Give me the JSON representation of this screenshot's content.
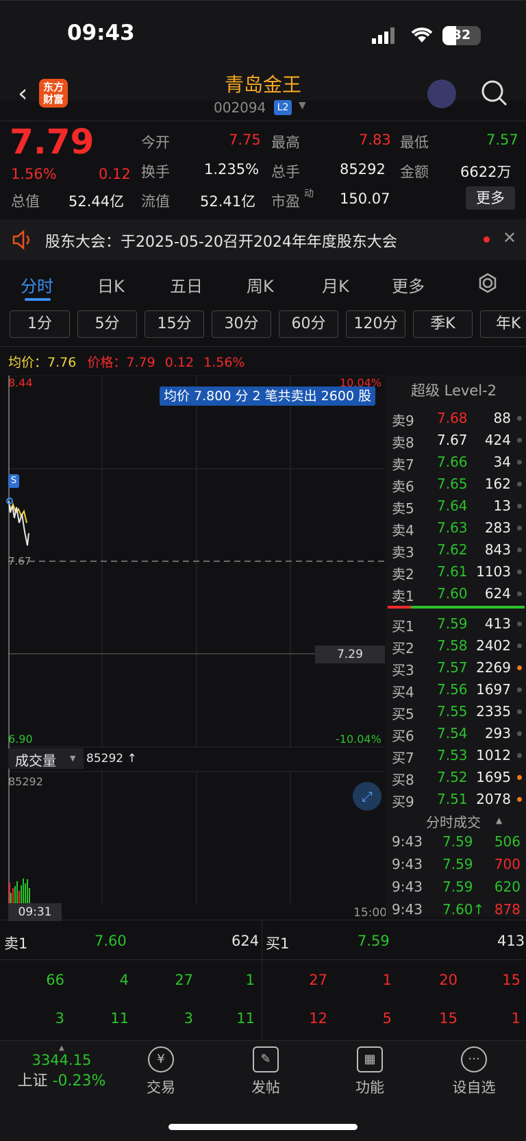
{
  "status": {
    "time": "09:43",
    "battery": "32"
  },
  "header": {
    "logo": "东方财富",
    "name": "青岛金王",
    "code": "002094",
    "badge": "L2"
  },
  "quote": {
    "price": "7.79",
    "pct": "1.56%",
    "chg": "0.12",
    "open_label": "今开",
    "open": "7.75",
    "high_label": "最高",
    "high": "7.83",
    "low_label": "最低",
    "low": "7.57",
    "turnover_label": "换手",
    "turnover": "1.235%",
    "vol_label": "总手",
    "vol": "85292",
    "amount_label": "金额",
    "amount": "6622万",
    "mcap_label": "总值",
    "mcap": "52.44亿",
    "float_label": "流值",
    "float": "52.41亿",
    "pe_label": "市盈",
    "pe_sup": "动",
    "pe": "150.07",
    "more": "更多"
  },
  "notice": {
    "text": "股东大会：于2025-05-20召开2024年年度股东大会"
  },
  "tabs": [
    "分时",
    "日K",
    "五日",
    "周K",
    "月K",
    "更多"
  ],
  "periods": [
    "1分",
    "5分",
    "15分",
    "30分",
    "60分",
    "120分",
    "季K",
    "年K"
  ],
  "legend": {
    "avg_label": "均价：",
    "avg": "7.76",
    "price_label": "价格：",
    "price": "7.79",
    "chg": "0.12",
    "pct": "1.56%"
  },
  "chart": {
    "y_top": "8.44",
    "y_bottom": "6.90",
    "pct_top": "10.04%",
    "pct_bottom": "-10.04%",
    "ref": "7.67",
    "cross": "7.29",
    "tooltip": "均价 7.800 分 2 笔共卖出 2600 股",
    "vol_label": "成交量",
    "vol_value": "85292 ↑",
    "vol_max": "85292",
    "t_start": "09:31",
    "t_end": "15:00"
  },
  "orderbook": {
    "title": "超级 Level-2",
    "sells": [
      {
        "l": "卖9",
        "p": "7.68",
        "v": "88",
        "c": "red"
      },
      {
        "l": "卖8",
        "p": "7.67",
        "v": "424",
        "c": "white"
      },
      {
        "l": "卖7",
        "p": "7.66",
        "v": "34",
        "c": "green"
      },
      {
        "l": "卖6",
        "p": "7.65",
        "v": "162",
        "c": "green"
      },
      {
        "l": "卖5",
        "p": "7.64",
        "v": "13",
        "c": "green"
      },
      {
        "l": "卖4",
        "p": "7.63",
        "v": "283",
        "c": "green"
      },
      {
        "l": "卖3",
        "p": "7.62",
        "v": "843",
        "c": "green"
      },
      {
        "l": "卖2",
        "p": "7.61",
        "v": "1103",
        "c": "green"
      },
      {
        "l": "卖1",
        "p": "7.60",
        "v": "624",
        "c": "green"
      }
    ],
    "buys": [
      {
        "l": "买1",
        "p": "7.59",
        "v": "413"
      },
      {
        "l": "买2",
        "p": "7.58",
        "v": "2402"
      },
      {
        "l": "买3",
        "p": "7.57",
        "v": "2269"
      },
      {
        "l": "买4",
        "p": "7.56",
        "v": "1697"
      },
      {
        "l": "买5",
        "p": "7.55",
        "v": "2335"
      },
      {
        "l": "买6",
        "p": "7.54",
        "v": "293"
      },
      {
        "l": "买7",
        "p": "7.53",
        "v": "1012"
      },
      {
        "l": "买8",
        "p": "7.52",
        "v": "1695"
      },
      {
        "l": "买9",
        "p": "7.51",
        "v": "2078"
      }
    ],
    "ticks_title": "分时成交",
    "ticks": [
      {
        "t": "9:43",
        "p": "7.59",
        "v": "506",
        "c": "green"
      },
      {
        "t": "9:43",
        "p": "7.59",
        "v": "700",
        "c": "red"
      },
      {
        "t": "9:43",
        "p": "7.59",
        "v": "620",
        "c": "green"
      },
      {
        "t": "9:43",
        "p": "7.60↑",
        "v": "878",
        "c": "red"
      }
    ]
  },
  "bottom": {
    "sell_label": "卖1",
    "sell_price": "7.60",
    "sell_vol": "624",
    "buy_label": "买1",
    "buy_price": "7.59",
    "buy_vol": "413",
    "sell_r1": [
      "66",
      "4",
      "27",
      "1"
    ],
    "sell_r2": [
      "3",
      "11",
      "3",
      "11"
    ],
    "buy_r1": [
      "27",
      "1",
      "20",
      "15"
    ],
    "buy_r2": [
      "12",
      "5",
      "15",
      "1"
    ]
  },
  "tabbar": {
    "index_value": "3344.15",
    "index_label": "上证",
    "index_pct": "-0.23%",
    "items": [
      "交易",
      "发帖",
      "功能",
      "设自选"
    ]
  }
}
